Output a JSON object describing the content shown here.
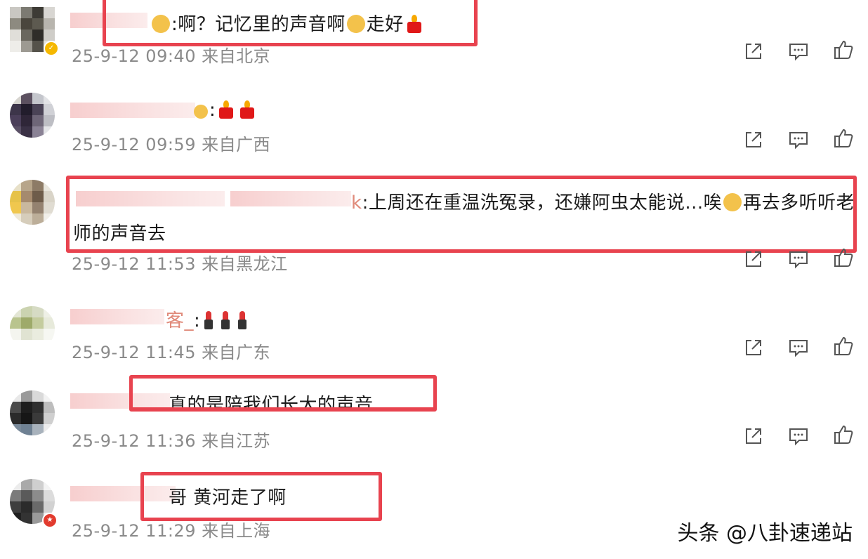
{
  "comments": [
    {
      "nick_tail": "",
      "text": ":啊？记忆里的声音啊",
      "text_after": "走好",
      "meta": "25-9-12 09:40 来自北京"
    },
    {
      "nick_tail": "",
      "text": ":",
      "meta": "25-9-12 09:59 来自广西"
    },
    {
      "nick_tail": "k",
      "text": ":上周还在重温洗冤录，还嫌阿虫太能说...唉",
      "text_after": "再去多听听老",
      "text_line2": "师的声音去",
      "meta": "25-9-12 11:53 来自黑龙江"
    },
    {
      "nick_tail": "客_",
      "text": ":",
      "meta": "25-9-12 11:45 来自广东"
    },
    {
      "nick_tail": "",
      "text": "真的是陪我们长大的声音",
      "meta": "25-9-12 11:36 来自江苏"
    },
    {
      "nick_tail": "",
      "text": "哥 黄河走了啊",
      "meta": "25-9-12 11:29 来自上海"
    }
  ],
  "actions": {
    "share": "share-icon",
    "reply": "comment-icon",
    "like": "thumbs-up-icon"
  },
  "colors": {
    "highlight": "#e8434f",
    "meta_text": "#8a8a8a",
    "nickname_blur": "#f6c9c9"
  },
  "watermark": "头条 @八卦速递站"
}
